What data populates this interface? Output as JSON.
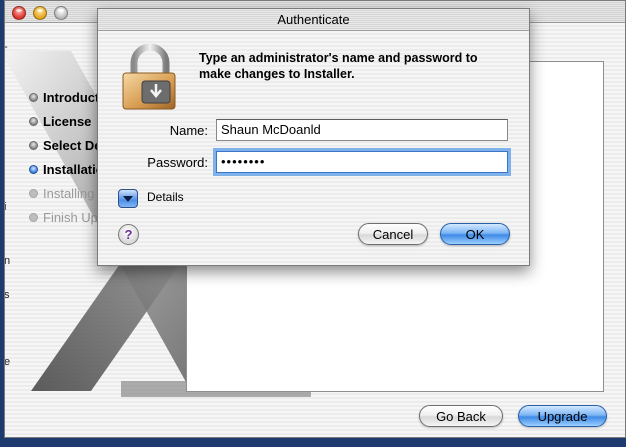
{
  "installer": {
    "steps": [
      {
        "label": "Introduction",
        "state": "done"
      },
      {
        "label": "License",
        "state": "done"
      },
      {
        "label": "Select Destination",
        "state": "done"
      },
      {
        "label": "Installation Type",
        "state": "current"
      },
      {
        "label": "Installing",
        "state": "future"
      },
      {
        "label": "Finish Up",
        "state": "future"
      }
    ],
    "back_label": "Go Back",
    "upgrade_label": "Upgrade"
  },
  "auth": {
    "title": "Authenticate",
    "prompt": "Type an administrator's name and password to make changes to Installer.",
    "name_label": "Name:",
    "name_value": "Shaun McDoanld",
    "password_label": "Password:",
    "password_value": "••••••••",
    "details_label": "Details",
    "help_label": "?",
    "cancel_label": "Cancel",
    "ok_label": "OK"
  },
  "colors": {
    "accent": "#3f8ae6",
    "desktop": "#1d3b6e"
  }
}
